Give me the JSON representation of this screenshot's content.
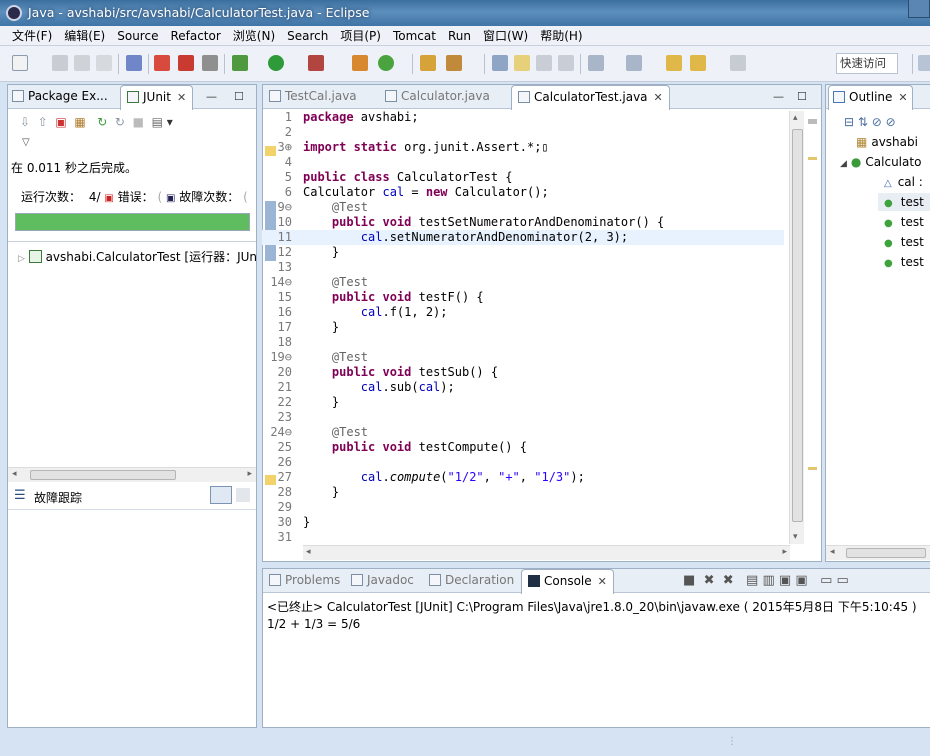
{
  "window": {
    "title": "Java - avshabi/src/avshabi/CalculatorTest.java - Eclipse"
  },
  "menu": [
    "文件(F)",
    "编辑(E)",
    "Source",
    "Refactor",
    "浏览(N)",
    "Search",
    "项目(P)",
    "Tomcat",
    "Run",
    "窗口(W)",
    "帮助(H)"
  ],
  "quick_access": "快速访问",
  "left_panel": {
    "tabs": [
      "Package Ex...",
      "JUnit"
    ],
    "status": "在 0.011 秒之后完成。",
    "runs_label": "运行次数：",
    "runs_value": "4/",
    "errors_label": "错误：",
    "failures_label": "故障次数：",
    "progress": 1.0,
    "progress_color": "#5fbd5f",
    "tree_item": "avshabi.CalculatorTest [运行器：JUn",
    "trace_title": "故障跟踪"
  },
  "editor": {
    "tabs": [
      "TestCal.java",
      "Calculator.java",
      "CalculatorTest.java"
    ],
    "active_tab": "CalculatorTest.java",
    "lines": [
      {
        "n": "1",
        "html": "<span class='kw'>package</span> avshabi;"
      },
      {
        "n": "2",
        "html": ""
      },
      {
        "n": "3⊕",
        "html": "<span class='kw'>import static</span> org.junit.Assert.*;&#x25AF;"
      },
      {
        "n": "4",
        "html": ""
      },
      {
        "n": "5",
        "html": "<span class='kw'>public class</span> CalculatorTest {"
      },
      {
        "n": "6",
        "html": "Calculator <span class='fld'>cal</span> = <span class='kw'>new</span> Calculator();"
      },
      {
        "n": "9⊖",
        "html": "    <span class='an'>@Test</span>"
      },
      {
        "n": "10",
        "html": "    <span class='kw'>public void</span> testSetNumeratorAndDenominator() {"
      },
      {
        "n": "11",
        "html": "        <span class='fld'>cal</span>.setNumeratorAndDenominator(2, 3);",
        "hl": true
      },
      {
        "n": "12",
        "html": "    }"
      },
      {
        "n": "13",
        "html": ""
      },
      {
        "n": "14⊖",
        "html": "    <span class='an'>@Test</span>"
      },
      {
        "n": "15",
        "html": "    <span class='kw'>public void</span> testF() {"
      },
      {
        "n": "16",
        "html": "        <span class='fld'>cal</span>.f(1, 2);"
      },
      {
        "n": "17",
        "html": "    }"
      },
      {
        "n": "18",
        "html": ""
      },
      {
        "n": "19⊖",
        "html": "    <span class='an'>@Test</span>"
      },
      {
        "n": "20",
        "html": "    <span class='kw'>public void</span> testSub() {"
      },
      {
        "n": "21",
        "html": "        <span class='fld'>cal</span>.sub(<span class='fld'>cal</span>);"
      },
      {
        "n": "22",
        "html": "    }"
      },
      {
        "n": "23",
        "html": ""
      },
      {
        "n": "24⊖",
        "html": "    <span class='an'>@Test</span>"
      },
      {
        "n": "25",
        "html": "    <span class='kw'>public void</span> testCompute() {"
      },
      {
        "n": "26",
        "html": ""
      },
      {
        "n": "27",
        "html": "        <span class='fld'>cal</span>.<span class='it'>compute</span>(<span class='str'>\"1/2\"</span>, <span class='str'>\"+\"</span>, <span class='str'>\"1/3\"</span>);"
      },
      {
        "n": "28",
        "html": "    }"
      },
      {
        "n": "29",
        "html": ""
      },
      {
        "n": "30",
        "html": "}"
      },
      {
        "n": "31",
        "html": ""
      }
    ]
  },
  "outline": {
    "title": "Outline",
    "items": [
      "avshabi",
      "Calculato",
      "cal :",
      "test",
      "test",
      "test",
      "test"
    ]
  },
  "console": {
    "tabs": [
      "Problems",
      "Javadoc",
      "Declaration",
      "Console"
    ],
    "header": "<已终止> CalculatorTest [JUnit] C:\\Program Files\\Java\\jre1.8.0_20\\bin\\javaw.exe ( 2015年5月8日 下午5:10:45 )",
    "output": "1/2 + 1/3 = 5/6"
  }
}
